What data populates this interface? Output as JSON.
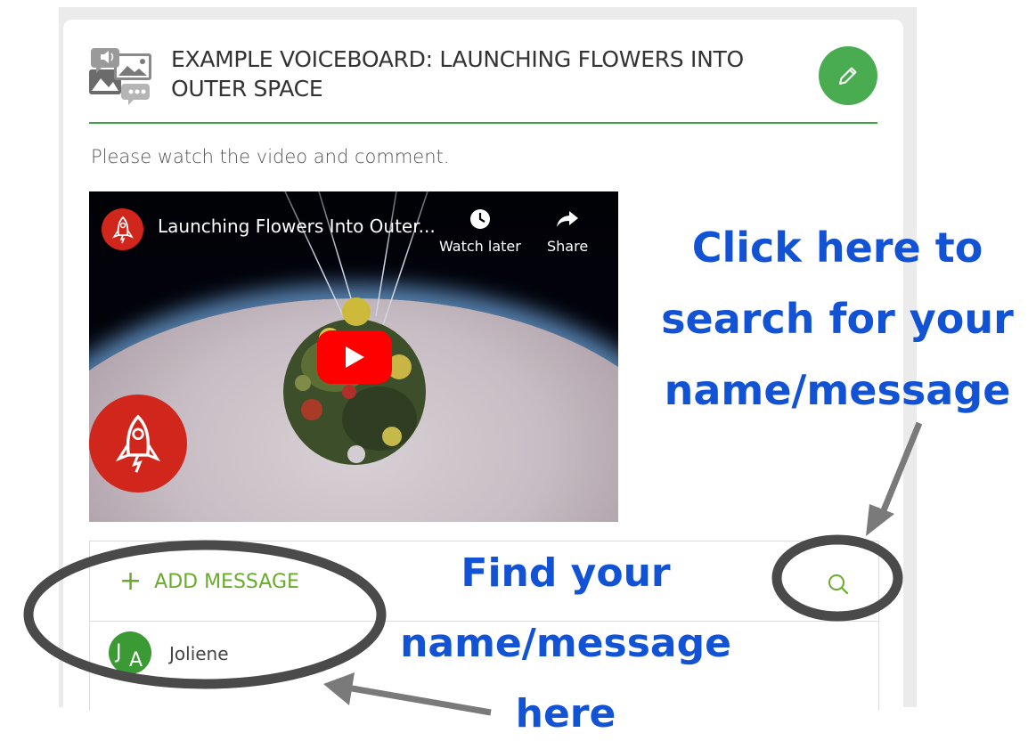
{
  "voiceboard": {
    "title": "EXAMPLE VOICEBOARD: LAUNCHING FLOWERS INTO OUTER SPACE",
    "description": "Please watch the video and comment."
  },
  "video": {
    "title": "Launching Flowers Into Outer...",
    "watch_later_label": "Watch later",
    "share_label": "Share"
  },
  "messages": {
    "add_label": "ADD MESSAGE",
    "items": [
      {
        "author": "Joliene",
        "initials_first": "J",
        "initials_second": "A"
      }
    ]
  },
  "annotations": {
    "search_hint": [
      "Click here to",
      "search for your",
      "name/message"
    ],
    "find_hint": [
      "Find your",
      "name/message",
      "here"
    ]
  },
  "colors": {
    "accent_green": "#4aac50",
    "link_green": "#6aab2d",
    "annotation_blue": "#1253d6",
    "youtube_red": "#ff0000",
    "channel_red": "#d0261c"
  },
  "icons": [
    "voiceboard-media-icon",
    "pencil-icon",
    "rocket-icon",
    "clock-icon",
    "share-arrow-icon",
    "play-icon",
    "plus-icon",
    "search-icon"
  ]
}
